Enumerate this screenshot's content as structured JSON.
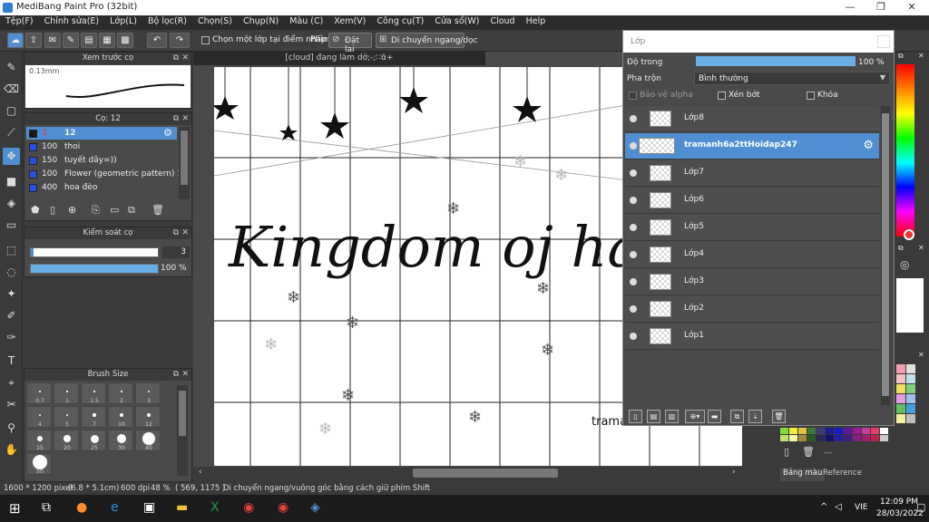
{
  "window": {
    "title": "MediBang Paint Pro (32bit)",
    "minimize": "—",
    "maximize": "❐",
    "close": "✕"
  },
  "menu": [
    "Tệp(F)",
    "Chỉnh sửa(E)",
    "Lớp(L)",
    "Bộ lọc(R)",
    "Chọn(S)",
    "Chụp(N)",
    "Màu (C)",
    "Xem(V)",
    "Công cụ(T)",
    "Cửa sổ(W)",
    "Cloud",
    "Help"
  ],
  "toolbar": {
    "select_one_layer_label": "Chọn một lớp tại điểm nhấp",
    "key_label": "Phím",
    "reset_label": "Đặt lại",
    "move_label": "Di chuyển ngang/dọc"
  },
  "preview_panel": {
    "title": "Xem trước cọ",
    "size": "0.13mm"
  },
  "brush_panel": {
    "title": "Cọ: 12",
    "items": [
      {
        "size": "3",
        "name": "12",
        "color": "#1a1a1a",
        "selected": true
      },
      {
        "size": "100",
        "name": "thoi",
        "color": "#2b4fe0",
        "selected": false
      },
      {
        "size": "150",
        "name": "tuyết dây=))",
        "color": "#2b4fe0",
        "selected": false
      },
      {
        "size": "100",
        "name": "Flower (geometric pattern) 1",
        "color": "#2b4fe0",
        "selected": false
      },
      {
        "size": "400",
        "name": "hoa đèo",
        "color": "#2b4fe0",
        "selected": false
      }
    ]
  },
  "control_panel": {
    "title": "Kiểm soát cọ",
    "size_value": "3",
    "opacity_value": "100 %",
    "opacity": 1.0
  },
  "brush_size_panel": {
    "title": "Brush Size",
    "sizes": [
      "0.7",
      "1",
      "1.5",
      "2",
      "3",
      "4",
      "5",
      "7",
      "10",
      "12",
      "15",
      "20",
      "25",
      "30",
      "40",
      "50"
    ]
  },
  "document": {
    "tab_title": "[cloud] đang làm dở;-;∷α̑+",
    "canvas_text": "Kingdom oj  hard",
    "signature": "trama"
  },
  "layer_window": {
    "title": "Lớp",
    "opacity_label": "Độ trong",
    "opacity_value": "100 %",
    "opacity": 1.0,
    "blend_label": "Pha trộn",
    "blend_value": "Bình thường",
    "protect_alpha": "Bảo vệ alpha",
    "clipping": "Xén bớt",
    "lock": "Khóa",
    "layers": [
      {
        "name": "Lớp8",
        "selected": false
      },
      {
        "name": "tramanh6a2ttHoidap247",
        "selected": true
      },
      {
        "name": "Lớp7",
        "selected": false
      },
      {
        "name": "Lớp6",
        "selected": false
      },
      {
        "name": "Lớp5",
        "selected": false
      },
      {
        "name": "Lớp4",
        "selected": false
      },
      {
        "name": "Lớp3",
        "selected": false
      },
      {
        "name": "Lớp2",
        "selected": false
      },
      {
        "name": "Lớp1",
        "selected": false
      }
    ]
  },
  "palette": {
    "tab_color": "Bảng màu",
    "tab_reference": "Reference",
    "dash": "---"
  },
  "status": {
    "size": "1600 * 1200 pixel",
    "dims": "(6.8 * 5.1cm)",
    "dpi": "600 dpi",
    "zoom": "48 %",
    "coords": "( 569, 1175 )",
    "hint": "Di chuyển ngang/vuông góc bằng cách giữ phím Shift"
  },
  "taskbar": {
    "lang": "VIE",
    "time": "12:09 PM",
    "date": "28/03/2022"
  }
}
